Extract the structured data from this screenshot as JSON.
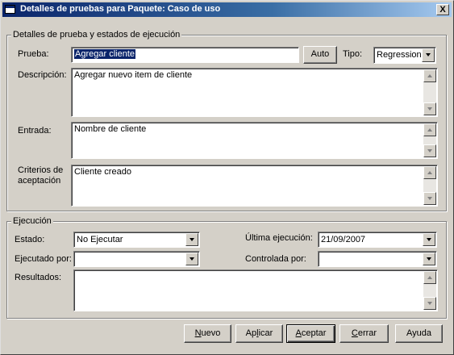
{
  "window": {
    "title": "Detalles de pruebas para Paquete: Caso de uso",
    "close_label": "X"
  },
  "details_group": {
    "legend": "Detalles de prueba y estados de ejecución",
    "prueba_label": "Prueba:",
    "prueba_value": "Agregar cliente",
    "auto_button": "Auto",
    "tipo_label": "Tipo:",
    "tipo_value": "Regression",
    "descripcion_label": "Descripción:",
    "descripcion_value": "Agregar nuevo item de cliente",
    "entrada_label": "Entrada:",
    "entrada_value": "Nombre de cliente",
    "criterios_label_1": "Criterios de",
    "criterios_label_2": "aceptación",
    "criterios_value": "Cliente creado"
  },
  "execution_group": {
    "legend": "Ejecución",
    "estado_label": "Estado:",
    "estado_value": "No Ejecutar",
    "ultima_label": "Última ejecución:",
    "ultima_value": "21/09/2007",
    "ejecutado_label": "Ejecutado por:",
    "ejecutado_value": "",
    "controlada_label": "Controlada por:",
    "controlada_value": "",
    "resultados_label": "Resultados:",
    "resultados_value": ""
  },
  "buttons": {
    "nuevo": {
      "mnemonic": "N",
      "rest": "uevo"
    },
    "aplicar": {
      "pre": "Ap",
      "mnemonic": "l",
      "rest": "icar"
    },
    "aceptar": {
      "mnemonic": "A",
      "rest": "ceptar"
    },
    "cerrar": {
      "mnemonic": "C",
      "rest": "errar"
    },
    "ayuda": {
      "label": "Ayuda"
    }
  }
}
